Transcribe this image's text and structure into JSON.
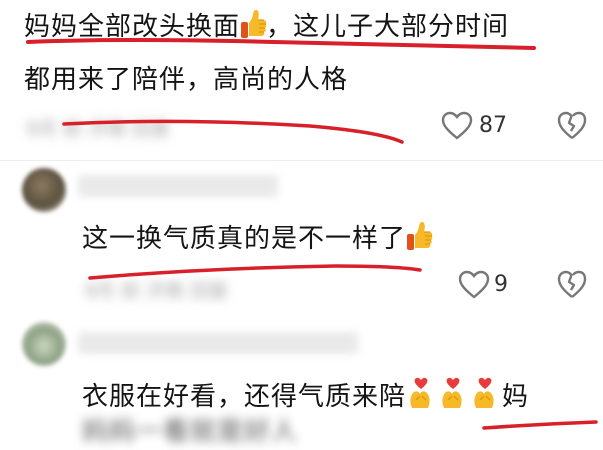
{
  "comments": [
    {
      "line1_prefix": "妈妈全部改头换面",
      "line1_suffix": "，这儿子大部分时间",
      "line2": "都用来了陪伴，高尚的人格",
      "meta_blurred": "9月 前  济南  回复",
      "like_count": "87",
      "emoji": "thumbs-up-icon"
    },
    {
      "text": "这一换气质真的是不一样了",
      "meta_blurred": "9月 前  济南  回复",
      "like_count": "9",
      "emoji": "thumbs-up-icon"
    },
    {
      "text": "衣服在好看，还得气质来陪",
      "text_suffix": "妈",
      "line2_blurred": "妈妈一看就是好人",
      "emoji": "heart-hands-icon"
    }
  ],
  "colors": {
    "underline_red": "#d8202a",
    "meta_gray": "#a6a6a6",
    "icon_gray": "#777777"
  }
}
